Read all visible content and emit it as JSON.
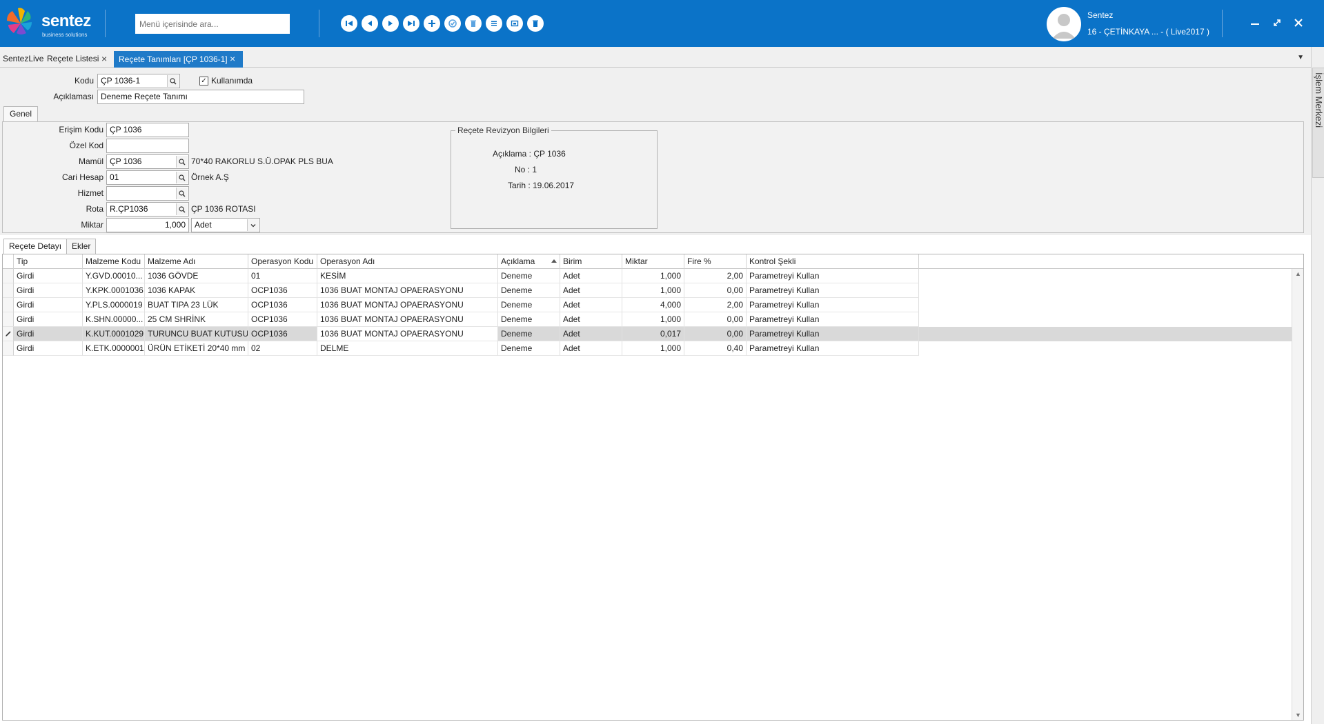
{
  "header": {
    "logo_text": "sentez",
    "logo_sub": "business solutions",
    "search_placeholder": "Menü içerisinde ara...",
    "user_name": "Sentez",
    "user_company": "16 - ÇETİNKAYA ... - ( Live2017 )",
    "nav_icons": [
      "first-record-icon",
      "previous-record-icon",
      "next-record-icon",
      "last-record-icon",
      "add-icon",
      "save-icon",
      "delete-icon",
      "list-icon",
      "window-icon",
      "trash-icon"
    ],
    "colors": {
      "accent": "#0b73c8",
      "selected_tab": "#1f7ac8"
    }
  },
  "tabs": [
    {
      "label": "SentezLive"
    },
    {
      "label": "Reçete Listesi",
      "close": "×"
    },
    {
      "label": "Reçete Tanımları [ÇP 1036-1]",
      "close": "×"
    }
  ],
  "side_panel": {
    "label": "İşlem Merkezi"
  },
  "form": {
    "kodu_label": "Kodu",
    "kodu_value": "ÇP 1036-1",
    "kullanimda_label": "Kullanımda",
    "kullanimda_checked": "✓",
    "aciklama_label": "Açıklaması",
    "aciklama_value": "Deneme Reçete Tanımı",
    "genel_tab": "Genel",
    "fields": {
      "erisim_kodu_label": "Erişim Kodu",
      "erisim_kodu_value": "ÇP 1036",
      "ozel_kod_label": "Özel Kod",
      "ozel_kod_value": "",
      "mamul_label": "Mamül",
      "mamul_value": "ÇP 1036",
      "mamul_desc": "70*40 RAKORLU S.Ü.OPAK PLS BUA",
      "cari_hesap_label": "Cari Hesap",
      "cari_hesap_value": "01",
      "cari_hesap_desc": "Örnek A.Ş",
      "hizmet_label": "Hizmet",
      "hizmet_value": "",
      "rota_label": "Rota",
      "rota_value": "R.ÇP1036",
      "rota_desc": "ÇP 1036 ROTASI",
      "miktar_label": "Miktar",
      "miktar_value": "1,000",
      "birim_value": "Adet"
    },
    "revizyon": {
      "title": "Reçete Revizyon Bilgileri",
      "aciklama": "Açıklama : ÇP 1036",
      "no": "No : 1",
      "tarih": "Tarih : 19.06.2017"
    }
  },
  "sub_tabs": [
    {
      "label": "Reçete Detayı"
    },
    {
      "label": "Ekler"
    }
  ],
  "grid": {
    "columns": [
      "Tip",
      "Malzeme Kodu",
      "Malzeme Adı",
      "Operasyon Kodu",
      "Operasyon Adı",
      "Açıklama",
      "Birim",
      "Miktar",
      "Fire %",
      "Kontrol Şekli"
    ],
    "rows": [
      [
        "Girdi",
        "Y.GVD.00010...",
        "1036 GÖVDE",
        "01",
        "KESİM",
        "Deneme",
        "Adet",
        "1,000",
        "2,00",
        "Parametreyi Kullan"
      ],
      [
        "Girdi",
        "Y.KPK.0001036",
        "1036 KAPAK",
        "OCP1036",
        "1036 BUAT MONTAJ OPAERASYONU",
        "Deneme",
        "Adet",
        "1,000",
        "0,00",
        "Parametreyi Kullan"
      ],
      [
        "Girdi",
        "Y.PLS.0000019",
        "BUAT TIPA 23 LÜK",
        "OCP1036",
        "1036 BUAT MONTAJ OPAERASYONU",
        "Deneme",
        "Adet",
        "4,000",
        "2,00",
        "Parametreyi Kullan"
      ],
      [
        "Girdi",
        "K.SHN.00000...",
        "25 CM SHRİNK",
        "OCP1036",
        "1036 BUAT MONTAJ OPAERASYONU",
        "Deneme",
        "Adet",
        "1,000",
        "0,00",
        "Parametreyi Kullan"
      ],
      [
        "Girdi",
        "K.KUT.0001029",
        "TURUNCU BUAT KUTUSU",
        "OCP1036",
        "1036 BUAT MONTAJ OPAERASYONU",
        "Deneme",
        "Adet",
        "0,017",
        "0,00",
        "Parametreyi Kullan"
      ],
      [
        "Girdi",
        "K.ETK.0000001",
        "ÜRÜN ETİKETİ 20*40 mm",
        "02",
        "DELME",
        "Deneme",
        "Adet",
        "1,000",
        "0,40",
        "Parametreyi Kullan"
      ]
    ],
    "selected_row": 4
  }
}
